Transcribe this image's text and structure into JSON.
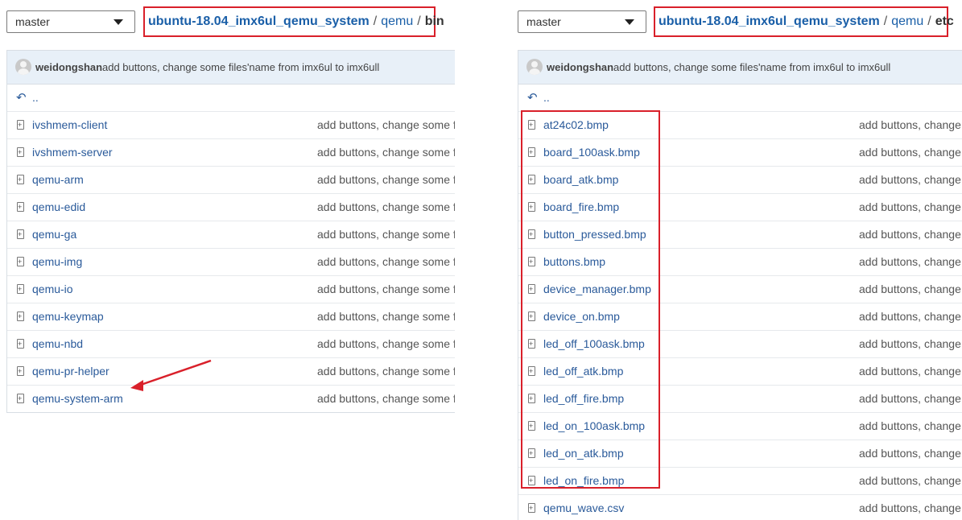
{
  "left": {
    "branch": "master",
    "breadcrumb": {
      "root": "ubuntu-18.04_imx6ul_qemu_system",
      "seg": "qemu",
      "current": "bin",
      "sep": "/"
    },
    "commit": {
      "author": "weidongshan",
      "message": "add buttons, change some files'name from imx6ul to imx6ull"
    },
    "updir": "..",
    "files": [
      {
        "name": "ivshmem-client",
        "commit": "add buttons, change some f"
      },
      {
        "name": "ivshmem-server",
        "commit": "add buttons, change some f"
      },
      {
        "name": "qemu-arm",
        "commit": "add buttons, change some f"
      },
      {
        "name": "qemu-edid",
        "commit": "add buttons, change some f"
      },
      {
        "name": "qemu-ga",
        "commit": "add buttons, change some f"
      },
      {
        "name": "qemu-img",
        "commit": "add buttons, change some f"
      },
      {
        "name": "qemu-io",
        "commit": "add buttons, change some f"
      },
      {
        "name": "qemu-keymap",
        "commit": "add buttons, change some f"
      },
      {
        "name": "qemu-nbd",
        "commit": "add buttons, change some f"
      },
      {
        "name": "qemu-pr-helper",
        "commit": "add buttons, change some f"
      },
      {
        "name": "qemu-system-arm",
        "commit": "add buttons, change some f"
      }
    ]
  },
  "right": {
    "branch": "master",
    "breadcrumb": {
      "root": "ubuntu-18.04_imx6ul_qemu_system",
      "seg": "qemu",
      "current": "etc",
      "sep": "/"
    },
    "commit": {
      "author": "weidongshan",
      "message": "add buttons, change some files'name from imx6ul to imx6ull"
    },
    "updir": "..",
    "files": [
      {
        "name": "at24c02.bmp",
        "commit": "add buttons, change"
      },
      {
        "name": "board_100ask.bmp",
        "commit": "add buttons, change"
      },
      {
        "name": "board_atk.bmp",
        "commit": "add buttons, change"
      },
      {
        "name": "board_fire.bmp",
        "commit": "add buttons, change"
      },
      {
        "name": "button_pressed.bmp",
        "commit": "add buttons, change"
      },
      {
        "name": "buttons.bmp",
        "commit": "add buttons, change"
      },
      {
        "name": "device_manager.bmp",
        "commit": "add buttons, change"
      },
      {
        "name": "device_on.bmp",
        "commit": "add buttons, change"
      },
      {
        "name": "led_off_100ask.bmp",
        "commit": "add buttons, change"
      },
      {
        "name": "led_off_atk.bmp",
        "commit": "add buttons, change"
      },
      {
        "name": "led_off_fire.bmp",
        "commit": "add buttons, change"
      },
      {
        "name": "led_on_100ask.bmp",
        "commit": "add buttons, change"
      },
      {
        "name": "led_on_atk.bmp",
        "commit": "add buttons, change"
      },
      {
        "name": "led_on_fire.bmp",
        "commit": "add buttons, change"
      },
      {
        "name": "qemu_wave.csv",
        "commit": "add buttons, change"
      }
    ]
  },
  "colors": {
    "highlight": "#d9202a",
    "link": "#2a5a9a",
    "commit_bar": "#e8f0f8"
  },
  "icons": {
    "file": "file-icon",
    "updir": "arrow-up-left-icon",
    "caret": "chevron-down-icon",
    "avatar": "user-avatar-icon"
  }
}
